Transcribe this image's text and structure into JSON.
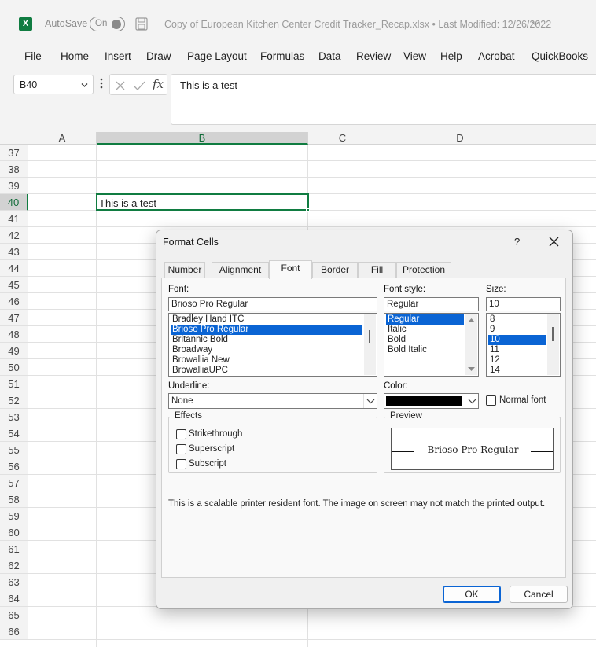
{
  "titlebar": {
    "app_logo": "X",
    "autosave_label": "AutoSave",
    "autosave_state": "On",
    "document_title": "Copy of European Kitchen Center Credit Tracker_Recap.xlsx",
    "modified": "Last Modified: 12/26/2022",
    "separator": "•",
    "icons": [
      "excel-logo-icon",
      "save-icon",
      "chevron-down-icon"
    ]
  },
  "menu": [
    "File",
    "Home",
    "Insert",
    "Draw",
    "Page Layout",
    "Formulas",
    "Data",
    "Review",
    "View",
    "Help",
    "Acrobat",
    "QuickBooks"
  ],
  "formula_bar": {
    "name_box": "B40",
    "fx_label": "fx",
    "content": "This is a test"
  },
  "grid": {
    "columns": [
      "A",
      "B",
      "C",
      "D"
    ],
    "selected_column": "B",
    "rows": [
      "37",
      "38",
      "39",
      "40",
      "41",
      "42",
      "43",
      "44",
      "45",
      "46",
      "47",
      "48",
      "49",
      "50",
      "51",
      "52",
      "53",
      "54",
      "55",
      "56",
      "57",
      "58",
      "59",
      "60",
      "61",
      "62",
      "63",
      "64",
      "65",
      "66"
    ],
    "selected_row": "40",
    "active_cell_value": "This is a test",
    "accent": "#107c41"
  },
  "dialog": {
    "title": "Format Cells",
    "help": "?",
    "tabs": [
      "Number",
      "Alignment",
      "Font",
      "Border",
      "Fill",
      "Protection"
    ],
    "active_tab": "Font",
    "font_label": "Font:",
    "font_value": "Brioso Pro Regular",
    "font_list": [
      "Bradley Hand ITC",
      "Brioso Pro Regular",
      "Britannic Bold",
      "Broadway",
      "Browallia New",
      "BrowalliaUPC"
    ],
    "font_selected": "Brioso Pro Regular",
    "style_label": "Font style:",
    "style_value": "Regular",
    "style_list": [
      "Regular",
      "Italic",
      "Bold",
      "Bold Italic"
    ],
    "style_selected": "Regular",
    "size_label": "Size:",
    "size_value": "10",
    "size_list": [
      "8",
      "9",
      "10",
      "11",
      "12",
      "14"
    ],
    "size_selected": "10",
    "underline_label": "Underline:",
    "underline_value": "None",
    "color_label": "Color:",
    "color_value": "#000000",
    "normal_font_label": "Normal font",
    "effects_title": "Effects",
    "effects": [
      "Strikethrough",
      "Superscript",
      "Subscript"
    ],
    "preview_title": "Preview",
    "preview_text": "Brioso Pro Regular",
    "note": "This is a scalable printer resident font.  The image on screen may not match the printed output.",
    "ok": "OK",
    "cancel": "Cancel",
    "selection_color": "#0a64d4"
  }
}
